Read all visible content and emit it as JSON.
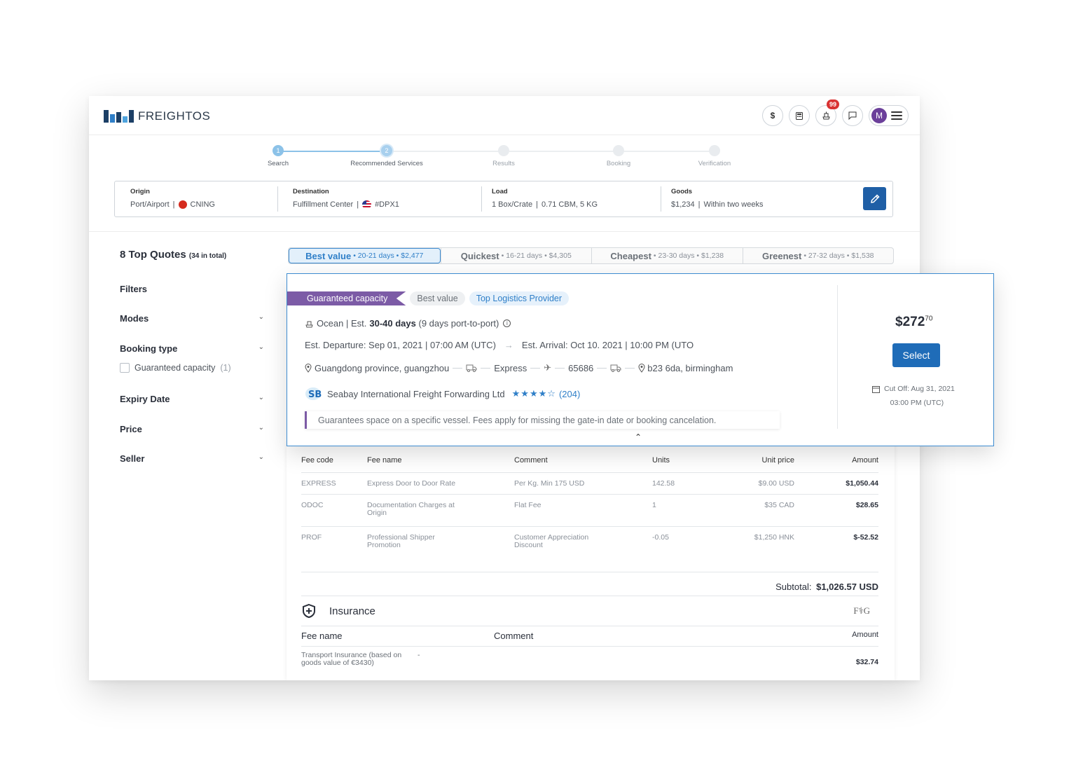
{
  "app": {
    "brand": "FREIGHTOS",
    "colors": {
      "brand_navy": "#1c3f66",
      "accent_blue": "#1f6cb8",
      "tag_purple": "#7c5ba6",
      "badge_red": "#d93232"
    }
  },
  "header": {
    "icons": [
      "dollar-icon",
      "calculator-icon",
      "ship-icon",
      "chat-icon"
    ],
    "currency_symbol": "$",
    "notification_count": "99",
    "avatar_initial": "M"
  },
  "stepper": {
    "steps": [
      {
        "num": "1",
        "label": "Search",
        "state": "done"
      },
      {
        "num": "2",
        "label": "Recommended Services",
        "state": "active"
      },
      {
        "num": "",
        "label": "Results",
        "state": "todo"
      },
      {
        "num": "",
        "label": "Booking",
        "state": "todo"
      },
      {
        "num": "",
        "label": "Verification",
        "state": "todo"
      }
    ]
  },
  "summary": {
    "origin": {
      "label": "Origin",
      "type": "Port/Airport",
      "sep": "|",
      "code": "CNING"
    },
    "destination": {
      "label": "Destination",
      "type": "Fulfillment Center",
      "sep": "|",
      "code": "#DPX1"
    },
    "load": {
      "label": "Load",
      "value": "1 Box/Crate",
      "sep": "|",
      "detail": "0.71 CBM, 5 KG"
    },
    "goods": {
      "label": "Goods",
      "value": "$1,234",
      "sep": "|",
      "detail": "Within two weeks"
    }
  },
  "sidebar": {
    "top_quotes": "8 Top Quotes",
    "total": "(34 in total)",
    "filters_title": "Filters",
    "filters": [
      {
        "label": "Modes"
      },
      {
        "label": "Booking type"
      },
      {
        "label": "Expiry Date"
      },
      {
        "label": "Price"
      },
      {
        "label": "Seller"
      }
    ],
    "guaranteed": {
      "label": "Guaranteed capacity",
      "count": "(1)",
      "checked": false
    }
  },
  "tabs": [
    {
      "name": "Best value",
      "detail": "• 20-21 days • $2,477",
      "active": true
    },
    {
      "name": "Quickest",
      "detail": "• 16-21 days • $4,305",
      "active": false
    },
    {
      "name": "Cheapest",
      "detail": "• 23-30 days • $1,238",
      "active": false
    },
    {
      "name": "Greenest",
      "detail": "• 27-32 days • $1,538",
      "active": false
    }
  ],
  "quote": {
    "tags": {
      "guaranteed": "Guaranteed capacity",
      "best_value": "Best value",
      "top_provider": "Top Logistics Provider"
    },
    "mode": "Ocean",
    "sep": "|",
    "est_prefix": "Est.",
    "duration": "30-40 days",
    "duration_detail": "(9 days port-to-port)",
    "departure": "Est. Departure: Sep 01, 2021 | 07:00 AM (UTC)",
    "arrival": "Est. Arrival: Oct 10. 2021 | 10:00 PM (UTO",
    "route": {
      "origin": "Guangdong province, guangzhou",
      "service": "Express",
      "flight": "65686",
      "destination": "b23 6da, birmingham"
    },
    "provider": "Seabay International Freight Forwarding Ltd",
    "rating": 4,
    "stars": "★★★★☆",
    "reviews": "(204)",
    "note": "Guarantees space on a specific vessel. Fees apply for missing the gate-in date or booking cancelation.",
    "price_main": "$272",
    "price_cents": "70",
    "select_label": "Select",
    "cutoff_line1": "Cut Off: Aug 31, 2021",
    "cutoff_line2": "03:00 PM (UTC)"
  },
  "fees": {
    "headers": [
      "Fee code",
      "Fee name",
      "Comment",
      "Units",
      "Unit price",
      "Amount"
    ],
    "rows": [
      {
        "code": "EXPRESS",
        "name": "Express Door to Door Rate",
        "comment": "Per Kg. Min 175 USD",
        "units": "142.58",
        "unit_price": "$9.00 USD",
        "amount": "$1,050.44"
      },
      {
        "code": "ODOC",
        "name": "Documentation Charges at Origin",
        "comment": "Flat Fee",
        "units": "1",
        "unit_price": "$35 CAD",
        "amount": "$28.65"
      },
      {
        "code": "PROF",
        "name": "Professional Shipper Promotion",
        "comment": "Customer Appreciation Discount",
        "units": "-0.05",
        "unit_price": "$1,250 HNK",
        "amount": "$-52.52"
      }
    ],
    "subtotal_label": "Subtotal:",
    "subtotal_value": "$1,026.57 USD"
  },
  "insurance": {
    "title": "Insurance",
    "logo": "F⚕G",
    "headers": [
      "Fee name",
      "Comment",
      "Amount"
    ],
    "row": {
      "name": "Transport Insurance (based on goods value of €3430)",
      "comment": "-",
      "amount": "$32.74"
    }
  }
}
